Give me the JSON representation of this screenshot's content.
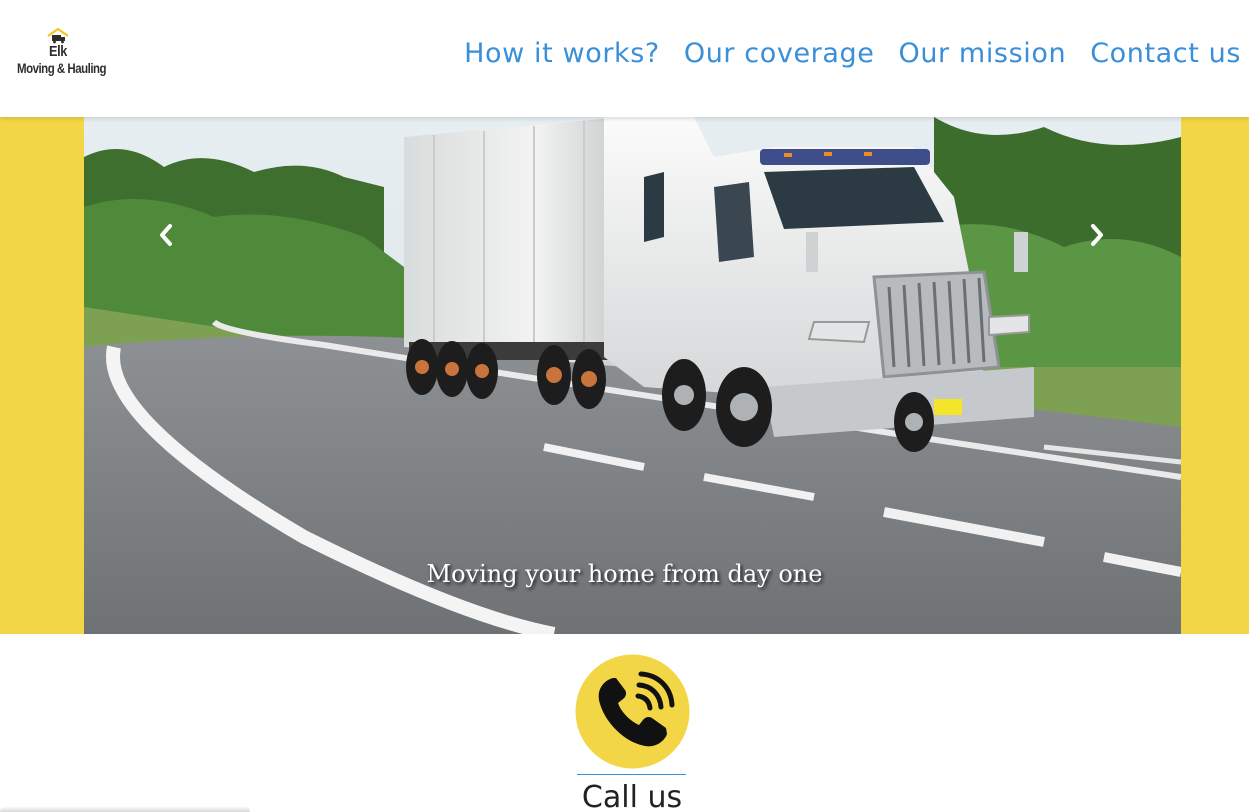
{
  "brand": {
    "name": "Elk",
    "tagline": "Moving & Hauling",
    "accent_color": "#f3d645",
    "link_color": "#3a8fd9",
    "logo_icon": "truck-house-icon"
  },
  "nav": {
    "items": [
      {
        "label": "How it works?"
      },
      {
        "label": "Our coverage"
      },
      {
        "label": "Our mission"
      },
      {
        "label": "Contact us"
      }
    ]
  },
  "carousel": {
    "caption": "Moving your home from day one",
    "prev_icon": "chevron-left-icon",
    "next_icon": "chevron-right-icon"
  },
  "call": {
    "icon": "phone-ringing-icon",
    "label": "Call us"
  }
}
